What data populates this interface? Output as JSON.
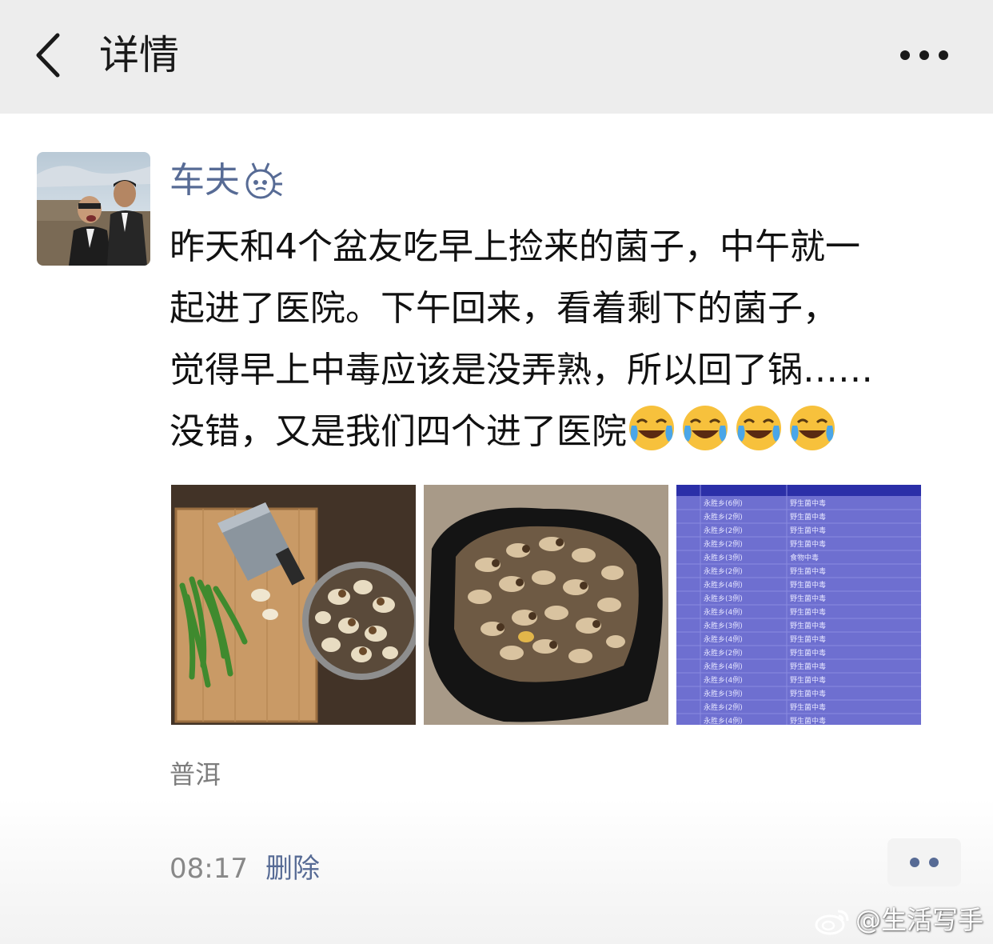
{
  "nav": {
    "title": "详情",
    "back_icon": "chevron-left-icon",
    "more_icon": "more-dots-icon"
  },
  "post": {
    "author": "车夫",
    "text_lines": [
      "昨天和4个盆友吃早上捡来的菌子，中午就一",
      "起进了医院。下午回来，看着剩下的菌子，",
      "觉得早上中毒应该是没弄熟，所以回了锅……",
      "没错，又是我们四个进了医院"
    ],
    "emojis": [
      "crying-laughing-emoji",
      "crying-laughing-emoji",
      "crying-laughing-emoji",
      "crying-laughing-emoji"
    ],
    "location": "普洱",
    "time": "08:17",
    "delete_label": "删除",
    "photo_3_rows": [
      [
        "永胜乡(6例)",
        "野生菌中毒"
      ],
      [
        "永胜乡(2例)",
        "野生菌中毒"
      ],
      [
        "永胜乡(2例)",
        "野生菌中毒"
      ],
      [
        "永胜乡(2例)",
        "野生菌中毒"
      ],
      [
        "永胜乡(3例)",
        "食物中毒"
      ],
      [
        "永胜乡(2例)",
        "野生菌中毒"
      ],
      [
        "永胜乡(4例)",
        "野生菌中毒"
      ],
      [
        "永胜乡(3例)",
        "野生菌中毒"
      ],
      [
        "永胜乡(4例)",
        "野生菌中毒"
      ],
      [
        "永胜乡(3例)",
        "野生菌中毒"
      ],
      [
        "永胜乡(4例)",
        "野生菌中毒"
      ],
      [
        "永胜乡(2例)",
        "野生菌中毒"
      ],
      [
        "永胜乡(4例)",
        "野生菌中毒"
      ],
      [
        "永胜乡(4例)",
        "野生菌中毒"
      ],
      [
        "永胜乡(3例)",
        "野生菌中毒"
      ],
      [
        "永胜乡(2例)",
        "野生菌中毒"
      ],
      [
        "永胜乡(4例)",
        "野生菌中毒"
      ]
    ]
  },
  "watermark": "@生活写手",
  "colors": {
    "link_blue": "#576b95",
    "nav_bg": "#ededed",
    "meta_gray": "#888888"
  }
}
